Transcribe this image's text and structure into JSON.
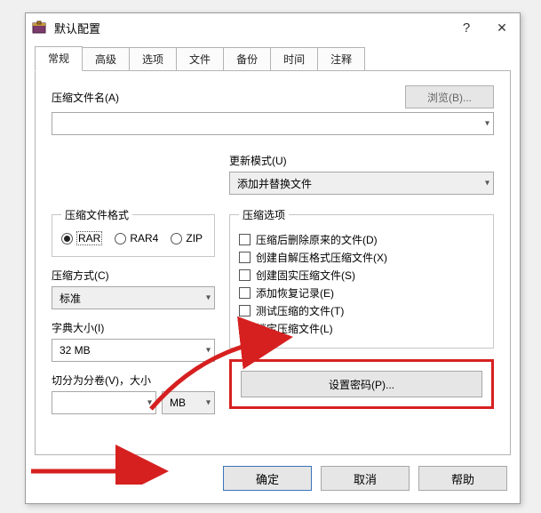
{
  "window": {
    "title": "默认配置",
    "help_glyph": "?",
    "close_glyph": "✕"
  },
  "tabs": [
    {
      "label": "常规",
      "active": true
    },
    {
      "label": "高级"
    },
    {
      "label": "选项"
    },
    {
      "label": "文件"
    },
    {
      "label": "备份"
    },
    {
      "label": "时间"
    },
    {
      "label": "注释"
    }
  ],
  "filename": {
    "label": "压缩文件名(A)",
    "browse": "浏览(B)...",
    "value": ""
  },
  "update_mode": {
    "label": "更新模式(U)",
    "value": "添加并替换文件"
  },
  "format": {
    "legend": "压缩文件格式",
    "options": [
      {
        "label": "RAR",
        "checked": true
      },
      {
        "label": "RAR4",
        "checked": false
      },
      {
        "label": "ZIP",
        "checked": false
      }
    ]
  },
  "method": {
    "label": "压缩方式(C)",
    "value": "标准"
  },
  "dict": {
    "label": "字典大小(I)",
    "value": "32 MB"
  },
  "split": {
    "label": "切分为分卷(V)，大小",
    "value": "",
    "unit": "MB"
  },
  "options": {
    "legend": "压缩选项",
    "items": [
      "压缩后删除原来的文件(D)",
      "创建自解压格式压缩文件(X)",
      "创建固实压缩文件(S)",
      "添加恢复记录(E)",
      "测试压缩的文件(T)",
      "锁定压缩文件(L)"
    ]
  },
  "password_btn": "设置密码(P)...",
  "buttons": {
    "ok": "确定",
    "cancel": "取消",
    "help": "帮助"
  }
}
